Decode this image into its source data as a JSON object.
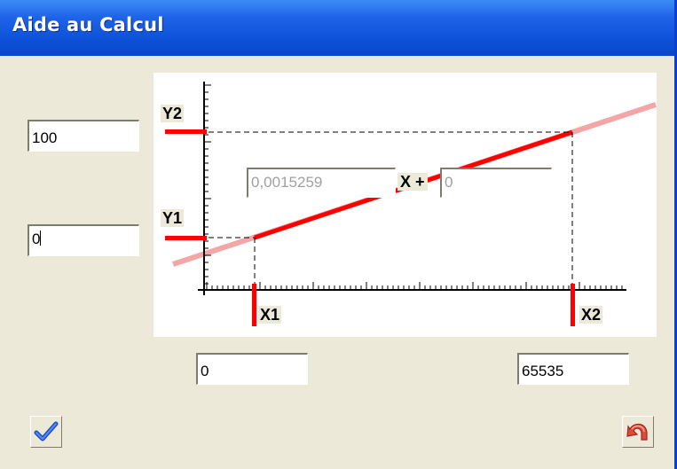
{
  "window": {
    "title": "Aide au Calcul"
  },
  "inputs": {
    "y2_value": "100",
    "y1_value": "0",
    "x1_value": "0",
    "x2_value": "65535"
  },
  "formula": {
    "slope": "0,0015259",
    "operator": "X +",
    "offset": "0"
  },
  "graph_labels": {
    "y2": "Y2",
    "y1": "Y1",
    "x1": "X1",
    "x2": "X2"
  },
  "colors": {
    "titlebar": "#0a4fd6",
    "line_active": "#ff0000",
    "line_extension": "#f4a6a6"
  },
  "icons": {
    "ok": "checkmark-icon",
    "cancel": "undo-icon"
  }
}
